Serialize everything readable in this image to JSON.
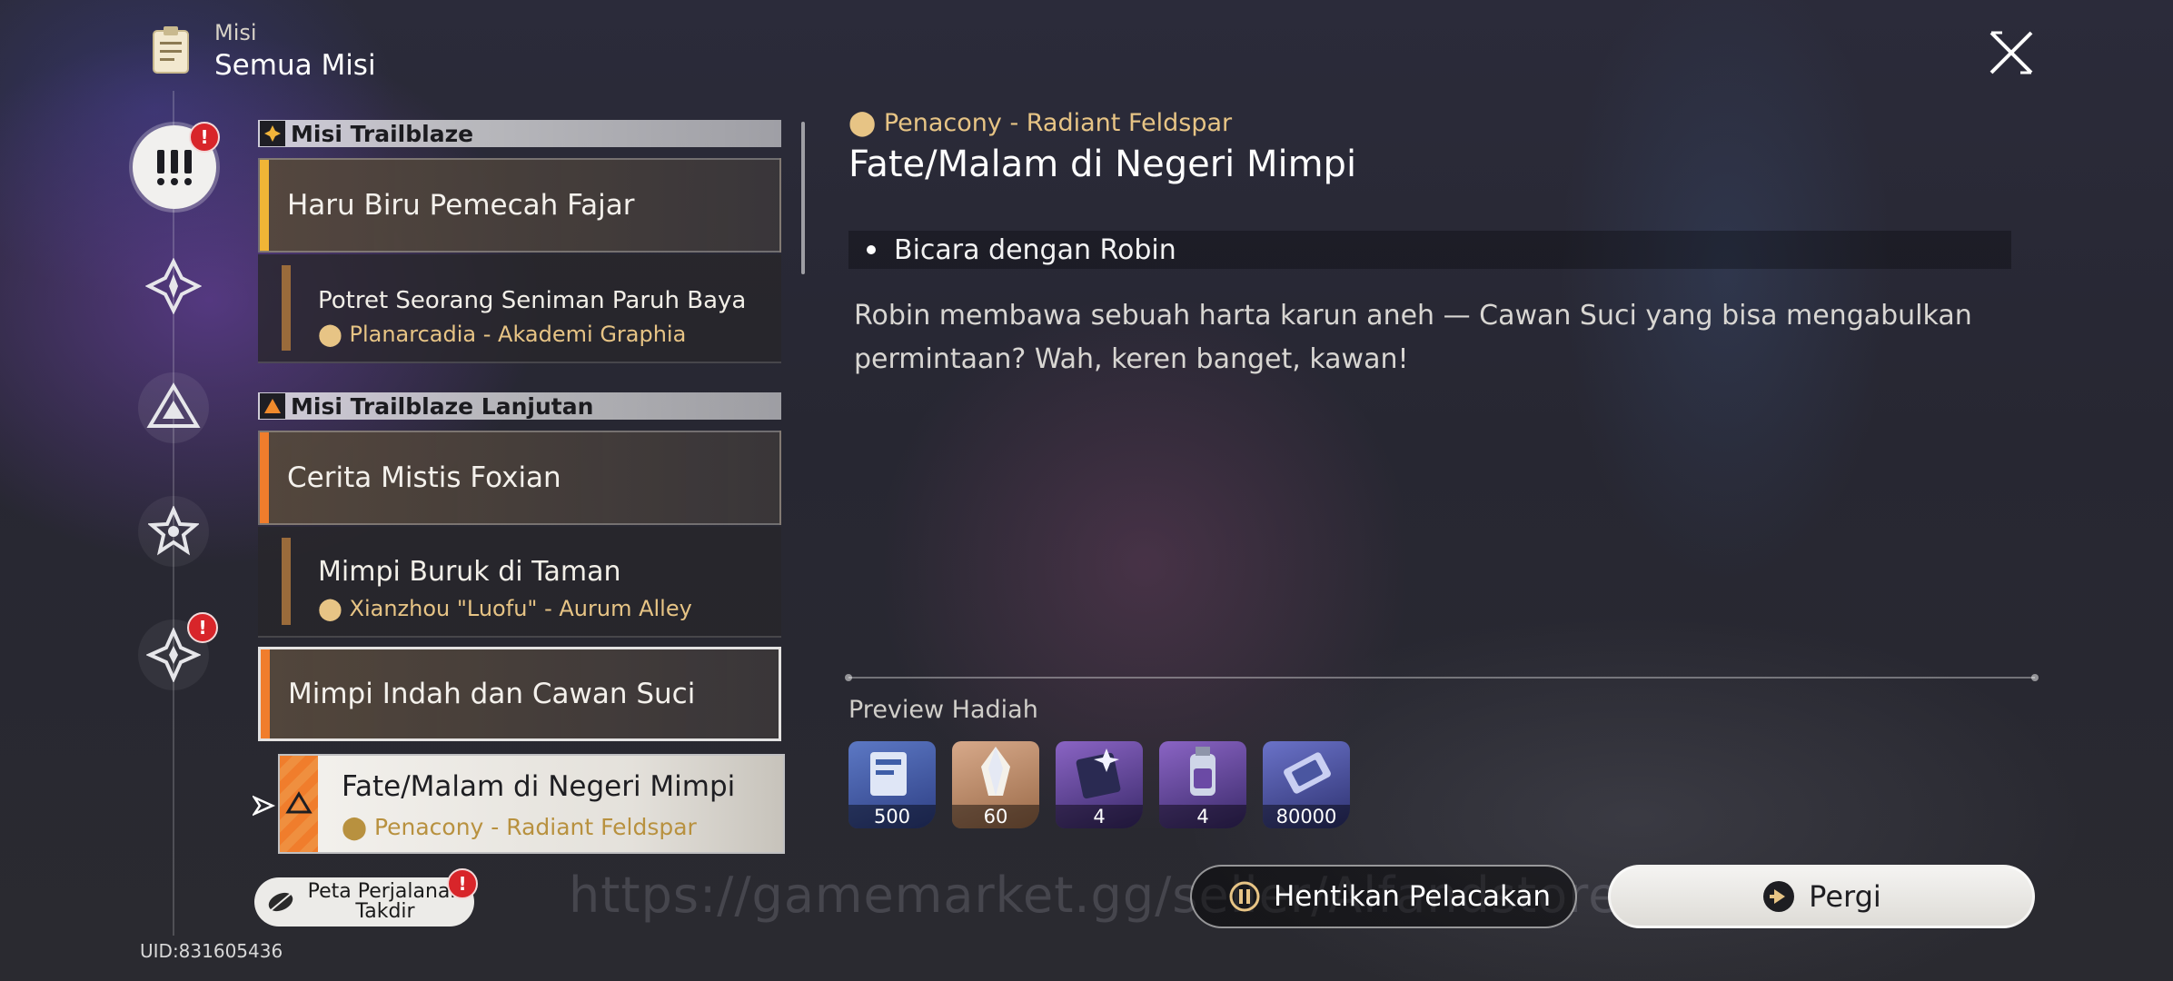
{
  "header": {
    "category": "Misi",
    "title": "Semua Misi"
  },
  "sidebar": {
    "uid": "UID:831605436",
    "icons": [
      "all-missions-icon",
      "trailblaze-icon",
      "companion-icon",
      "adventure-icon",
      "daily-icon"
    ]
  },
  "quest_list": {
    "sections": [
      {
        "label": "Misi Trailblaze",
        "main": "Haru Biru Pemecah Fajar",
        "sub_title": "Potret Seorang Seniman Paruh Baya",
        "sub_location": "Planarcadia - Akademi Graphia"
      },
      {
        "label": "Misi Trailblaze Lanjutan",
        "main": "Cerita Mistis Foxian",
        "sub_title": "Mimpi Buruk di Taman",
        "sub_location": "Xianzhou \"Luofu\" - Aurum Alley",
        "main2": "Mimpi Indah dan Cawan Suci",
        "selected_title": "Fate/Malam di Negeri Mimpi",
        "selected_location": "Penacony - Radiant Feldspar"
      }
    ]
  },
  "detail": {
    "location": "Penacony - Radiant Feldspar",
    "title": "Fate/Malam di Negeri Mimpi",
    "objective": "Bicara dengan Robin",
    "description": "Robin membawa sebuah harta karun aneh — Cawan Suci yang bisa mengabulkan permintaan? Wah, keren banget, kawan!",
    "reward_title": "Preview Hadiah",
    "rewards": [
      {
        "icon": "exp-book-icon",
        "qty": "500",
        "color": "#3f5ea8"
      },
      {
        "icon": "stellar-jade-icon",
        "qty": "60",
        "color": "#b98a64"
      },
      {
        "icon": "traveler-guide-icon",
        "qty": "4",
        "color": "#6b4aa5"
      },
      {
        "icon": "refined-aether-icon",
        "qty": "4",
        "color": "#6b4aa5"
      },
      {
        "icon": "credit-icon",
        "qty": "80000",
        "color": "#4a56a0"
      }
    ]
  },
  "buttons": {
    "journey": "Peta Perjalanan Takdir",
    "stop": "Hentikan Pelacakan",
    "go": "Pergi"
  },
  "watermark": "https://gamemarket.gg/seller/Alfandstore"
}
